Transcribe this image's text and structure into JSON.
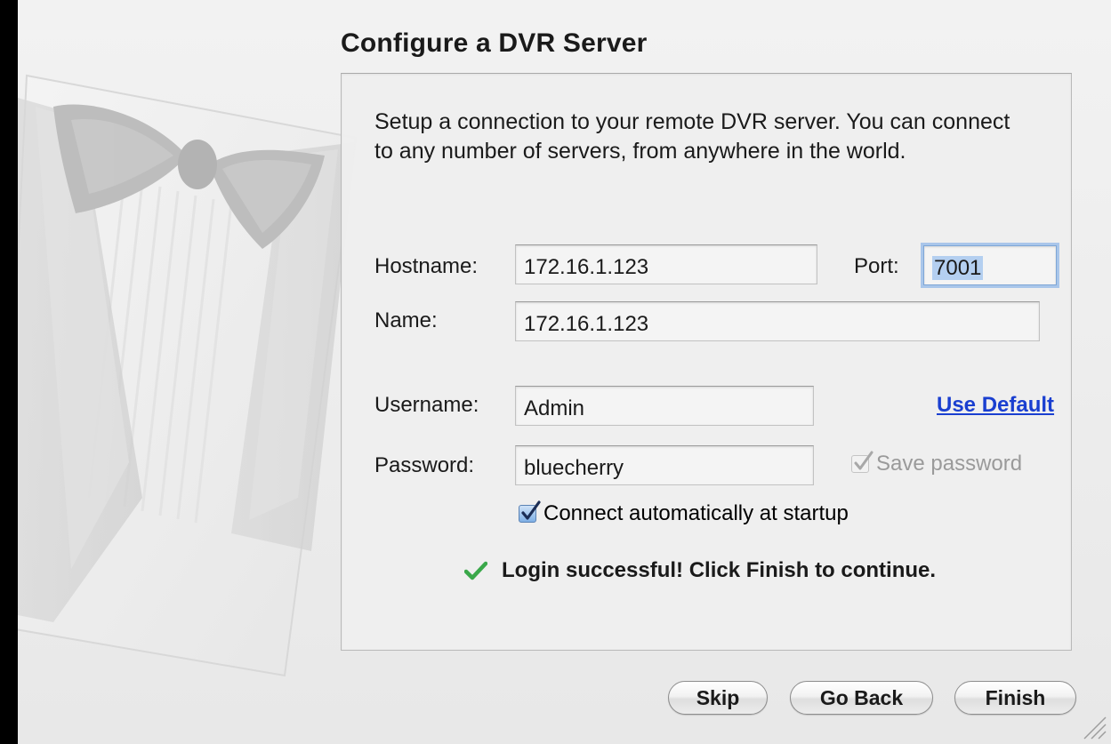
{
  "dialog": {
    "title": "Configure a DVR Server",
    "description": "Setup a connection to your remote DVR server. You can connect to any number of servers, from anywhere in the world."
  },
  "form": {
    "hostname_label": "Hostname:",
    "hostname_value": "172.16.1.123",
    "port_label": "Port:",
    "port_value": "7001",
    "name_label": "Name:",
    "name_value": "172.16.1.123",
    "username_label": "Username:",
    "username_value": "Admin",
    "use_default_link": "Use Default",
    "password_label": "Password:",
    "password_value": "bluecherry",
    "save_password_label": "Save password",
    "save_password_checked": true,
    "save_password_enabled": false,
    "auto_connect_label": "Connect automatically at startup",
    "auto_connect_checked": true
  },
  "status": {
    "message": "Login successful! Click Finish to continue.",
    "icon": "checkmark-icon",
    "color": "#3aa84a"
  },
  "buttons": {
    "skip": "Skip",
    "go_back": "Go Back",
    "finish": "Finish"
  },
  "colors": {
    "link": "#1a3fd0",
    "focus_ring": "#a9c6ea"
  }
}
